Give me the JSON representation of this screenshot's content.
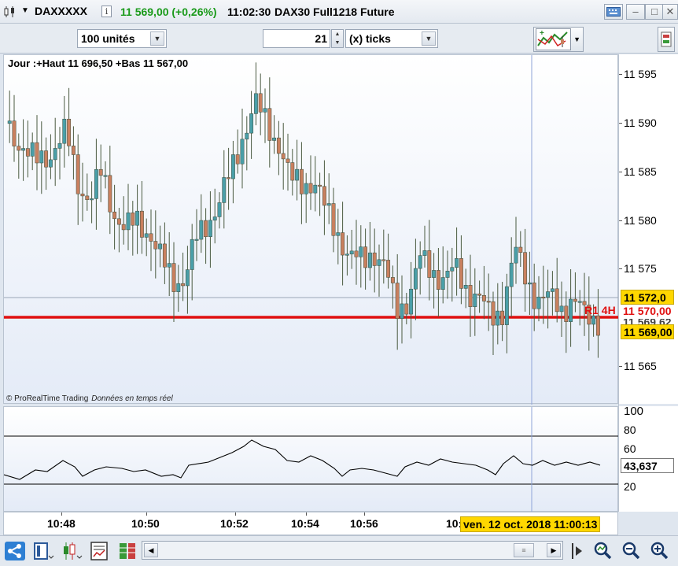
{
  "titlebar": {
    "symbol": "DAXXXXX",
    "info": "i",
    "price": "11 569,00 (+0,26%)",
    "time": "11:02:30",
    "name": "DAX30 Full1218 Future",
    "min": "–",
    "max": "□",
    "close": "✕"
  },
  "toolbar": {
    "units": "100 unités",
    "ticks_value": "21",
    "ticks_mode": "(x) ticks",
    "dropdown_arrow": "▼",
    "step_up": "▲",
    "step_down": "▼"
  },
  "chart": {
    "header": "Jour :+Haut 11 696,50 +Bas 11 567,00",
    "copyright": "© ProRealTime Trading",
    "realtime": "Données en temps réel",
    "r1_label": "R1 4H",
    "y_labels": [
      "11 595",
      "11 590",
      "11 585",
      "11 580",
      "11 575",
      "11 565"
    ],
    "price_tags": {
      "cursor": "11 572,0",
      "r1": "11 570,00",
      "other": "11 569,62",
      "last": "11 569,00"
    },
    "colors": {
      "up": "#4a9fa8",
      "down": "#c9805f",
      "r1": "#e01010",
      "rsi": "#000000"
    }
  },
  "rsi": {
    "y_labels": [
      "100",
      "80",
      "60",
      "20"
    ],
    "current": "43,637"
  },
  "timeaxis": {
    "labels": [
      "10:48",
      "10:50",
      "10:52",
      "10:54",
      "10:56",
      "10:"
    ],
    "cursor_date": "ven. 12 oct. 2018 11:00:13"
  },
  "bottombar": {
    "scroll_left": "◀",
    "scroll_right": "▶",
    "thumb": "≡"
  }
}
